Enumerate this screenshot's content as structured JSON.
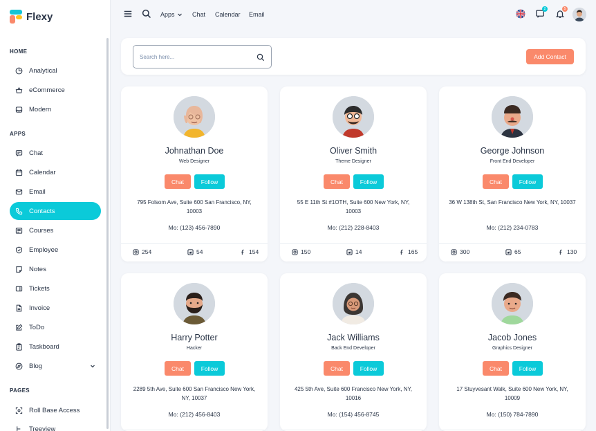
{
  "app": {
    "title": "Flexy"
  },
  "sidebar": {
    "sections": [
      {
        "label": "HOME"
      },
      {
        "label": "APPS"
      },
      {
        "label": "PAGES"
      }
    ],
    "items": [
      {
        "label": "Analytical",
        "icon": "pie-chart-icon"
      },
      {
        "label": "eCommerce",
        "icon": "basket-icon"
      },
      {
        "label": "Modern",
        "icon": "inbox-icon"
      },
      {
        "label": "Chat",
        "icon": "message-icon"
      },
      {
        "label": "Calendar",
        "icon": "calendar-icon"
      },
      {
        "label": "Email",
        "icon": "mail-icon"
      },
      {
        "label": "Contacts",
        "icon": "phone-icon",
        "active": true
      },
      {
        "label": "Courses",
        "icon": "book-icon"
      },
      {
        "label": "Employee",
        "icon": "shield-icon"
      },
      {
        "label": "Notes",
        "icon": "note-icon"
      },
      {
        "label": "Tickets",
        "icon": "ticket-icon"
      },
      {
        "label": "Invoice",
        "icon": "file-icon"
      },
      {
        "label": "ToDo",
        "icon": "edit-icon"
      },
      {
        "label": "Taskboard",
        "icon": "clipboard-icon"
      },
      {
        "label": "Blog",
        "icon": "blog-icon"
      },
      {
        "label": "Roll Base Access",
        "icon": "lock-icon"
      },
      {
        "label": "Treeview",
        "icon": "tree-icon"
      }
    ]
  },
  "topbar": {
    "apps_label": "Apps",
    "chat_label": "Chat",
    "calendar_label": "Calendar",
    "email_label": "Email",
    "messages_badge": "2",
    "notifications_badge": "5"
  },
  "search": {
    "placeholder": "Search here..."
  },
  "add_contact_label": "Add Contact",
  "colors": {
    "accent": "#0bcad9",
    "secondary": "#fa896b",
    "background": "#f4f6fa"
  },
  "contacts": [
    {
      "name": "Johnathan Doe",
      "role": "Web Designer",
      "address": "795 Folsom Ave, Suite 600 San Francisco, NY, 10003",
      "phone": "Mo: (123) 456-7890",
      "stats": [
        "254",
        "54",
        "154"
      ],
      "chat_label": "Chat",
      "follow_label": "Follow"
    },
    {
      "name": "Oliver Smith",
      "role": "Theme Designer",
      "address": "55 E 11th St #1OTH, Suite 600 New York, NY, 10003",
      "phone": "Mo: (212) 228-8403",
      "stats": [
        "150",
        "14",
        "165"
      ],
      "chat_label": "Chat",
      "follow_label": "Follow"
    },
    {
      "name": "George Johnson",
      "role": "Front End Developer",
      "address": "36 W 138th St, San Francisco New York, NY, 10037",
      "phone": "Mo: (212) 234-0783",
      "stats": [
        "300",
        "65",
        "130"
      ],
      "chat_label": "Chat",
      "follow_label": "Follow"
    },
    {
      "name": "Harry Potter",
      "role": "Hacker",
      "address": "2289 5th Ave, Suite 600 San Francisco New York, NY, 10037",
      "phone": "Mo: (212) 456-8403",
      "stats": [
        "",
        "",
        ""
      ],
      "chat_label": "Chat",
      "follow_label": "Follow"
    },
    {
      "name": "Jack Williams",
      "role": "Back End Developer",
      "address": "425 5th Ave, Suite 600 Francisco New York, NY, 10016",
      "phone": "Mo: (154) 456-8745",
      "stats": [
        "",
        "",
        ""
      ],
      "chat_label": "Chat",
      "follow_label": "Follow"
    },
    {
      "name": "Jacob Jones",
      "role": "Graphics Designer",
      "address": "17 Stuyvesant Walk, Suite 600 New York, NY, 10009",
      "phone": "Mo: (150) 784-7890",
      "stats": [
        "",
        "",
        ""
      ],
      "chat_label": "Chat",
      "follow_label": "Follow"
    }
  ]
}
